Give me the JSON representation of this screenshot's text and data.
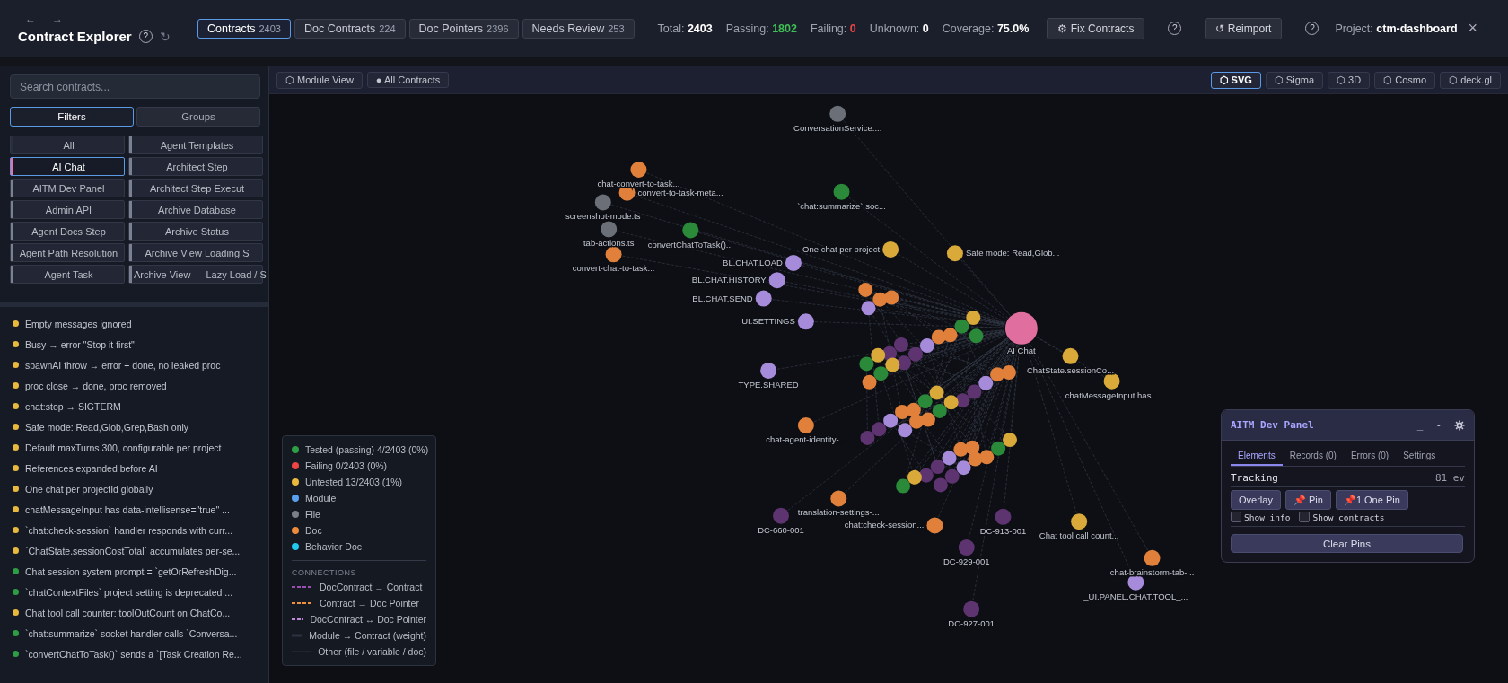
{
  "header": {
    "nav": [
      "←",
      "→"
    ],
    "title": "Contract Explorer",
    "help": "?",
    "refresh": "↻",
    "tabs": [
      {
        "label": "Contracts",
        "count": "2403",
        "selected": true
      },
      {
        "label": "Doc Contracts",
        "count": "224",
        "selected": false
      },
      {
        "label": "Doc Pointers",
        "count": "2396",
        "selected": false
      },
      {
        "label": "Needs Review",
        "count": "253",
        "selected": false
      }
    ],
    "stats": [
      {
        "label": "Total:",
        "value": "2403",
        "kind": "plain"
      },
      {
        "label": "Passing:",
        "value": "1802",
        "kind": "good"
      },
      {
        "label": "Failing:",
        "value": "0",
        "kind": "bad"
      },
      {
        "label": "Unknown:",
        "value": "0",
        "kind": "plain"
      },
      {
        "label": "Coverage:",
        "value": "75.0%",
        "kind": "plain"
      }
    ],
    "fix_button": "⚙ Fix Contracts",
    "reimport_button": "↺ Reimport",
    "help_marks": [
      "?",
      "?"
    ],
    "project_label": "Project:",
    "project": "ctm-dashboard",
    "close": "×"
  },
  "sidebar": {
    "search": {
      "placeholder": "Search contracts..."
    },
    "modes": [
      {
        "label": "Filters",
        "selected": true
      },
      {
        "label": "Groups",
        "selected": false
      }
    ],
    "filters_left": [
      {
        "label": "All",
        "selected": false,
        "color": "#2a2f3d"
      },
      {
        "label": "AI Chat",
        "selected": true,
        "color": "#ec6fa8"
      },
      {
        "label": "AITM Dev Panel",
        "selected": false,
        "color": "#7b8190"
      },
      {
        "label": "Admin API",
        "selected": false,
        "color": "#7b8190"
      },
      {
        "label": "Agent Docs Step",
        "selected": false,
        "color": "#7b8190"
      },
      {
        "label": "Agent Path Resolution",
        "selected": false,
        "color": "#7b8190"
      },
      {
        "label": "Agent Task",
        "selected": false,
        "color": "#7b8190"
      }
    ],
    "filters_right": [
      {
        "label": "Agent Templates",
        "selected": false,
        "color": "#7b8190"
      },
      {
        "label": "Architect Step",
        "selected": false,
        "color": "#7b8190"
      },
      {
        "label": "Architect Step Execut",
        "selected": false,
        "color": "#7b8190"
      },
      {
        "label": "Archive Database",
        "selected": false,
        "color": "#7b8190"
      },
      {
        "label": "Archive Status",
        "selected": false,
        "color": "#7b8190"
      },
      {
        "label": "Archive View Loading S",
        "selected": false,
        "color": "#7b8190"
      },
      {
        "label": "Archive View — Lazy Load / S",
        "selected": false,
        "color": "#7b8190"
      }
    ],
    "contracts": [
      {
        "text": "Empty messages ignored",
        "color": "#e8b93c"
      },
      {
        "text": "Busy → error \"Stop it first\"",
        "color": "#e8b93c"
      },
      {
        "text": "spawnAI throw → error + done, no leaked proc",
        "color": "#e8b93c"
      },
      {
        "text": "proc close → done, proc removed",
        "color": "#e8b93c"
      },
      {
        "text": "chat:stop → SIGTERM",
        "color": "#e8b93c"
      },
      {
        "text": "Safe mode: Read,Glob,Grep,Bash only",
        "color": "#e8b93c"
      },
      {
        "text": "Default maxTurns 300, configurable per project",
        "color": "#e8b93c"
      },
      {
        "text": "References expanded before AI",
        "color": "#e8b93c"
      },
      {
        "text": "One chat per projectId globally",
        "color": "#e8b93c"
      },
      {
        "text": "chatMessageInput has data-intellisense=\"true\" ...",
        "color": "#e8b93c"
      },
      {
        "text": "`chat:check-session` handler responds with curr...",
        "color": "#e8b93c"
      },
      {
        "text": "`ChatState.sessionCostTotal` accumulates per-se...",
        "color": "#e8b93c"
      },
      {
        "text": "Chat session system prompt = `getOrRefreshDig...",
        "color": "#2e9e44"
      },
      {
        "text": "`chatContextFiles` project setting is deprecated ...",
        "color": "#2e9e44"
      },
      {
        "text": "Chat tool call counter: toolOutCount on ChatCo...",
        "color": "#e8b93c"
      },
      {
        "text": "`chat:summarize` socket handler calls `Conversa...",
        "color": "#2e9e44"
      },
      {
        "text": "`convertChatToTask()` sends a `[Task Creation Re...",
        "color": "#2e9e44"
      }
    ]
  },
  "graph": {
    "views": [
      {
        "label": "⬡ Module View",
        "selected": false
      },
      {
        "label": "● All Contracts",
        "selected": false
      }
    ],
    "renderers": [
      {
        "label": "⬡ SVG",
        "selected": true
      },
      {
        "label": "⬡ Sigma",
        "selected": false
      },
      {
        "label": "⬡ 3D",
        "selected": false
      },
      {
        "label": "⬡ Cosmo",
        "selected": false
      },
      {
        "label": "⬡ deck.gl",
        "selected": false
      }
    ],
    "nodes": [
      {
        "label": "ConversationService....",
        "color": "#6b7078",
        "kind": "node"
      },
      {
        "label": "chat-convert-to-task...",
        "color": "#e0803a",
        "kind": "node"
      },
      {
        "label": "convert-to-task-meta...",
        "color": "#e0803a",
        "kind": "node"
      },
      {
        "label": "screenshot-mode.ts",
        "color": "#6b7078",
        "kind": "node"
      },
      {
        "label": "tab-actions.ts",
        "color": "#6b7078",
        "kind": "node"
      },
      {
        "label": "convert-chat-to-task...",
        "color": "#e0803a",
        "kind": "node"
      },
      {
        "label": "`chat:summarize` soc...",
        "color": "#2a8a3a",
        "kind": "node"
      },
      {
        "label": "convertChatToTask()...",
        "color": "#2a8a3a",
        "kind": "node"
      },
      {
        "label": "BL.CHAT.LOAD",
        "color": "#a78bdb",
        "kind": "node"
      },
      {
        "label": "BL.CHAT.HISTORY",
        "color": "#a78bdb",
        "kind": "node"
      },
      {
        "label": "BL.CHAT.SEND",
        "color": "#a78bdb",
        "kind": "node"
      },
      {
        "label": "UI.SETTINGS",
        "color": "#a78bdb",
        "kind": "node"
      },
      {
        "label": "TYPE.SHARED",
        "color": "#a78bdb",
        "kind": "node"
      },
      {
        "label": "One chat per project",
        "color": "#d9a93a",
        "kind": "node"
      },
      {
        "label": "Safe mode: Read,Glob...",
        "color": "#d9a93a",
        "kind": "node"
      },
      {
        "label": "AI Chat",
        "color": "#e06fa0",
        "kind": "hub"
      },
      {
        "label": "ChatState.sessionCo...",
        "color": "#d9a93a",
        "kind": "node"
      },
      {
        "label": "chatMessageInput has...",
        "color": "#d9a93a",
        "kind": "node"
      },
      {
        "label": "chat-agent-identity-...",
        "color": "#e0803a",
        "kind": "node"
      },
      {
        "label": "DC-660-001",
        "color": "#5e3470",
        "kind": "node"
      },
      {
        "label": "translation-settings-...",
        "color": "#e0803a",
        "kind": "node"
      },
      {
        "label": "chat:check-session...",
        "color": "#e0803a",
        "kind": "node"
      },
      {
        "label": "DC-913-001",
        "color": "#5e3470",
        "kind": "node"
      },
      {
        "label": "DC-929-001",
        "color": "#5e3470",
        "kind": "node"
      },
      {
        "label": "Chat tool call count...",
        "color": "#d9a93a",
        "kind": "node"
      },
      {
        "label": "chat-brainstorm-tab-...",
        "color": "#e0803a",
        "kind": "node"
      },
      {
        "label": "_UI.PANEL.CHAT.TOOL_...",
        "color": "#a78bdb",
        "kind": "node"
      },
      {
        "label": "DC-927-001",
        "color": "#5e3470",
        "kind": "node"
      }
    ],
    "legend": {
      "items": [
        {
          "label": "Tested (passing) 4/2403 (0%)",
          "color": "#2e9e44"
        },
        {
          "label": "Failing 0/2403 (0%)",
          "color": "#ef4444"
        },
        {
          "label": "Untested 13/2403 (1%)",
          "color": "#e8b93c"
        },
        {
          "label": "Module",
          "color": "#5aa0f0"
        },
        {
          "label": "File",
          "color": "#7b7f87"
        },
        {
          "label": "Doc",
          "color": "#ee8a3c"
        },
        {
          "label": "Behavior Doc",
          "color": "#22c8ee"
        }
      ],
      "connections_title": "CONNECTIONS",
      "connections": [
        {
          "label": "DocContract → Contract",
          "kind": "dashed",
          "color": "#9b4fb0"
        },
        {
          "label": "Contract → Doc Pointer",
          "kind": "dashed",
          "color": "#f0913c"
        },
        {
          "label": "DocContract ↔ Doc Pointer",
          "kind": "dashed",
          "color": "#c08ad8"
        },
        {
          "label": "Module → Contract (weight)",
          "kind": "solid",
          "color": "#2c3240"
        },
        {
          "label": "Other (file / variable / doc)",
          "kind": "thin",
          "color": "#242a36"
        }
      ]
    }
  },
  "dev_panel": {
    "title": "AITM Dev Panel",
    "minimize": "_",
    "collapse": "-",
    "tabs": [
      {
        "label": "Elements",
        "selected": true
      },
      {
        "label": "Records (0)",
        "selected": false
      },
      {
        "label": "Errors (0)",
        "selected": false
      },
      {
        "label": "Settings",
        "selected": false
      }
    ],
    "tracking_label": "Tracking",
    "tracking_count": "81 ev",
    "buttons": [
      "Overlay",
      "📌 Pin",
      "📌1 One Pin"
    ],
    "checkboxes": [
      {
        "label": "Show info",
        "checked": false
      },
      {
        "label": "Show contracts",
        "checked": false
      }
    ],
    "clear_button": "Clear Pins"
  }
}
